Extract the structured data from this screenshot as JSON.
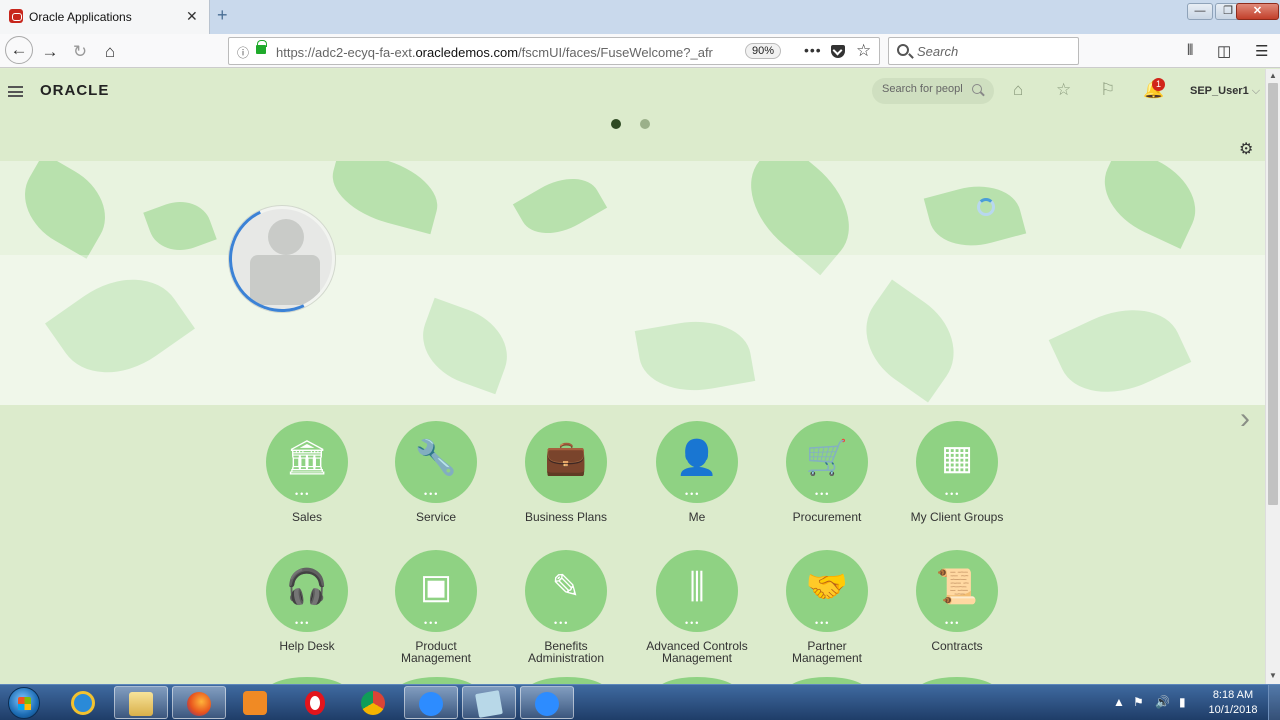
{
  "browser": {
    "tab_title": "Oracle Applications",
    "tab_close": "✕",
    "new_tab": "+",
    "url_scheme": "https://adc2-ecyq-fa-ext.",
    "url_host": "oracledemos.com",
    "url_path": "/fscmUI/faces/FuseWelcome?_afr",
    "zoom": "90%",
    "search_placeholder": "Search",
    "window_buttons": {
      "minimize": "—",
      "restore": "❐",
      "close": "✕"
    }
  },
  "header": {
    "logo": "ORACLE",
    "people_search_placeholder": "Search for people",
    "notification_count": "1",
    "user_name": "SEP_User1",
    "user_chevron": "⌵"
  },
  "carousel": {
    "page_count": 2,
    "active_page": 1
  },
  "springboard": {
    "row1": [
      {
        "label": "Sales",
        "icon": "sales-icon",
        "glyph": "🏛"
      },
      {
        "label": "Service",
        "icon": "service-icon",
        "glyph": "🔧"
      },
      {
        "label": "Business Plans",
        "icon": "briefcase-icon",
        "glyph": "💼"
      },
      {
        "label": "Me",
        "icon": "person-icon",
        "glyph": "👤"
      },
      {
        "label": "Procurement",
        "icon": "cart-icon",
        "glyph": "🛒"
      },
      {
        "label": "My Client Groups",
        "icon": "client-groups-icon",
        "glyph": "▦"
      }
    ],
    "row2": [
      {
        "label": "Help Desk",
        "icon": "headset-icon",
        "glyph": "🎧"
      },
      {
        "label": "Product\nManagement",
        "icon": "boxes-icon",
        "glyph": "▣"
      },
      {
        "label": "Benefits\nAdministration",
        "icon": "benefits-icon",
        "glyph": "✎"
      },
      {
        "label": "Advanced Controls\nManagement",
        "icon": "sliders-icon",
        "glyph": "⫼"
      },
      {
        "label": "Partner\nManagement",
        "icon": "handshake-icon",
        "glyph": "🤝"
      },
      {
        "label": "Contracts",
        "icon": "scroll-icon",
        "glyph": "📜"
      }
    ]
  },
  "taskbar": {
    "apps": [
      "internet-explorer-icon",
      "file-explorer-icon",
      "firefox-icon",
      "media-player-icon",
      "opera-icon",
      "chrome-icon",
      "zoom-icon",
      "notepad-icon",
      "zoom-meeting-icon"
    ],
    "time": "8:18 AM",
    "date": "10/1/2018"
  },
  "colors": {
    "tile": "#8fd283",
    "page_bg": "#dcebcc",
    "badge": "#d1251a"
  }
}
